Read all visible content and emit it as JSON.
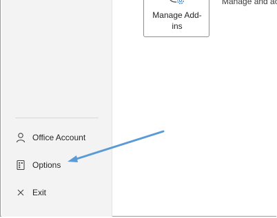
{
  "sidebar": {
    "items": [
      {
        "id": "office-account",
        "label": "Office Account",
        "icon": "person-icon"
      },
      {
        "id": "options",
        "label": "Options",
        "icon": "options-icon"
      },
      {
        "id": "exit",
        "label": "Exit",
        "icon": "close-icon"
      }
    ]
  },
  "main": {
    "manage_addins_button": {
      "label_line1": "Manage Add-",
      "label_line2": "ins",
      "icon": "addins-gear-icon"
    },
    "addins_description": "Manage and ac"
  },
  "annotation": {
    "color": "#5b9bd5",
    "type": "arrow",
    "points_to": "Options"
  },
  "colors": {
    "sidebar_bg": "#f3f3f3",
    "accent_blue": "#5b9bd5",
    "text": "#242424"
  }
}
